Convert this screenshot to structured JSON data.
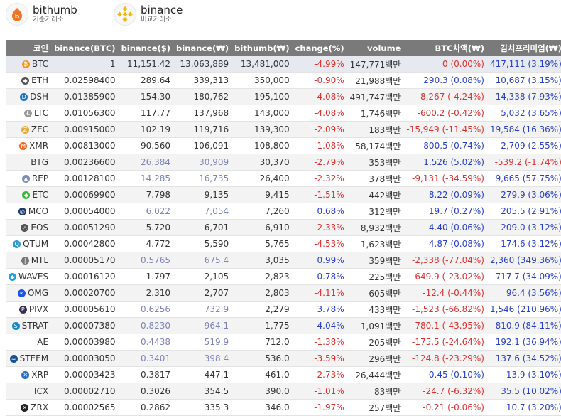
{
  "exchanges": {
    "bithumb": {
      "name": "bithumb",
      "sub": "기준거래소"
    },
    "binance": {
      "name": "binance",
      "sub": "비교거래소"
    }
  },
  "columns": [
    "코인",
    "binance(BTC)",
    "binance($)",
    "binance(₩)",
    "bithumb(₩)",
    "change(%)",
    "volume",
    "BTC차액(₩)",
    "김치프리미엄(₩)"
  ],
  "rows": [
    {
      "coin": "BTC",
      "icon": "bitcoin-icon",
      "icolor": "#f7931a",
      "glyph": "₿",
      "bbtc": "1",
      "busd": "11,151.42",
      "bkrw": "13,063,889",
      "bth": "13,481,000",
      "chg": "-4.99%",
      "vol": "147,771백만",
      "diff": "0 (0.00%)",
      "kimchi": "417,111 (3.19%)",
      "dimUsd": false
    },
    {
      "coin": "ETH",
      "icon": "ethereum-icon",
      "icolor": "#555",
      "glyph": "◆",
      "bbtc": "0.02598400",
      "busd": "289.64",
      "bkrw": "339,313",
      "bth": "350,000",
      "chg": "-0.90%",
      "vol": "21,988백만",
      "diff": "290.3 (0.08%)",
      "kimchi": "10,687 (3.15%)",
      "dimUsd": false
    },
    {
      "coin": "DSH",
      "icon": "dash-icon",
      "icolor": "#1c75bc",
      "glyph": "D",
      "bbtc": "0.01385900",
      "busd": "154.30",
      "bkrw": "180,762",
      "bth": "195,100",
      "chg": "-4.08%",
      "vol": "491,747백만",
      "diff": "-8,267 (-4.24%)",
      "kimchi": "14,338 (7.93%)",
      "dimUsd": false
    },
    {
      "coin": "LTC",
      "icon": "litecoin-icon",
      "icolor": "#9a9a9a",
      "glyph": "Ł",
      "bbtc": "0.01056300",
      "busd": "117.77",
      "bkrw": "137,968",
      "bth": "143,000",
      "chg": "-4.08%",
      "vol": "1,746백만",
      "diff": "-600.2 (-0.42%)",
      "kimchi": "5,032 (3.65%)",
      "dimUsd": false
    },
    {
      "coin": "ZEC",
      "icon": "zcash-icon",
      "icolor": "#e5a93d",
      "glyph": "Z",
      "bbtc": "0.00915000",
      "busd": "102.19",
      "bkrw": "119,716",
      "bth": "139,300",
      "chg": "-2.09%",
      "vol": "183백만",
      "diff": "-15,949 (-11.45%)",
      "kimchi": "19,584 (16.36%)",
      "dimUsd": false
    },
    {
      "coin": "XMR",
      "icon": "monero-icon",
      "icolor": "#f26822",
      "glyph": "M",
      "bbtc": "0.00813000",
      "busd": "90.560",
      "bkrw": "106,091",
      "bth": "108,800",
      "chg": "-1.08%",
      "vol": "58,174백만",
      "diff": "800.5 (0.74%)",
      "kimchi": "2,709 (2.55%)",
      "dimUsd": false
    },
    {
      "coin": "BTG",
      "icon": "",
      "icolor": "",
      "glyph": "",
      "bbtc": "0.00236600",
      "busd": "26.384",
      "bkrw": "30,909",
      "bth": "30,370",
      "chg": "-2.79%",
      "vol": "353백만",
      "diff": "1,526 (5.02%)",
      "kimchi": "-539.2 (-1.74%)",
      "dimUsd": true
    },
    {
      "coin": "REP",
      "icon": "augur-icon",
      "icolor": "#7c8fb3",
      "glyph": "▲",
      "bbtc": "0.00128100",
      "busd": "14.285",
      "bkrw": "16,735",
      "bth": "26,400",
      "chg": "-2.32%",
      "vol": "378백만",
      "diff": "-9,131 (-34.59%)",
      "kimchi": "9,665 (57.75%)",
      "dimUsd": true
    },
    {
      "coin": "ETC",
      "icon": "ethereum-classic-icon",
      "icolor": "#3ab83a",
      "glyph": "◆",
      "bbtc": "0.00069900",
      "busd": "7.798",
      "bkrw": "9,135",
      "bth": "9,415",
      "chg": "-1.51%",
      "vol": "442백만",
      "diff": "8.22 (0.09%)",
      "kimchi": "279.9 (3.06%)",
      "dimUsd": false
    },
    {
      "coin": "MCO",
      "icon": "monaco-icon",
      "icolor": "#1d3a6b",
      "glyph": "◎",
      "bbtc": "0.00054000",
      "busd": "6.022",
      "bkrw": "7,054",
      "bth": "7,260",
      "chg": "0.68%",
      "vol": "312백만",
      "diff": "19.7 (0.27%)",
      "kimchi": "205.5 (2.91%)",
      "dimUsd": true
    },
    {
      "coin": "EOS",
      "icon": "eos-icon",
      "icolor": "#555",
      "glyph": "△",
      "bbtc": "0.00051290",
      "busd": "5.720",
      "bkrw": "6,701",
      "bth": "6,910",
      "chg": "-2.33%",
      "vol": "8,932백만",
      "diff": "4.40 (0.06%)",
      "kimchi": "209.0 (3.12%)",
      "dimUsd": false
    },
    {
      "coin": "QTUM",
      "icon": "qtum-icon",
      "icolor": "#2e9ad0",
      "glyph": "Q",
      "bbtc": "0.00042800",
      "busd": "4.772",
      "bkrw": "5,590",
      "bth": "5,765",
      "chg": "-4.53%",
      "vol": "1,623백만",
      "diff": "4.87 (0.08%)",
      "kimchi": "174.6 (3.12%)",
      "dimUsd": false
    },
    {
      "coin": "MTL",
      "icon": "metal-icon",
      "icolor": "#777",
      "glyph": "|",
      "bbtc": "0.00005170",
      "busd": "0.5765",
      "bkrw": "675.4",
      "bth": "3,035",
      "chg": "0.99%",
      "vol": "359백만",
      "diff": "-2,338 (-77.04%)",
      "kimchi": "2,360 (349.36%)",
      "dimUsd": true
    },
    {
      "coin": "WAVES",
      "icon": "waves-icon",
      "icolor": "#1fa0d8",
      "glyph": "◆",
      "bbtc": "0.00016120",
      "busd": "1.797",
      "bkrw": "2,105",
      "bth": "2,823",
      "chg": "0.78%",
      "vol": "225백만",
      "diff": "-649.9 (-23.02%)",
      "kimchi": "717.7 (34.09%)",
      "dimUsd": false
    },
    {
      "coin": "OMG",
      "icon": "omisego-icon",
      "icolor": "#1a53f0",
      "glyph": "∞",
      "bbtc": "0.00020700",
      "busd": "2.310",
      "bkrw": "2,707",
      "bth": "2,803",
      "chg": "-4.11%",
      "vol": "605백만",
      "diff": "-12.4 (-0.44%)",
      "kimchi": "96.4 (3.56%)",
      "dimUsd": false
    },
    {
      "coin": "PIVX",
      "icon": "pivx-icon",
      "icolor": "#3b2f4f",
      "glyph": "P",
      "bbtc": "0.00005610",
      "busd": "0.6256",
      "bkrw": "732.9",
      "bth": "2,279",
      "chg": "3.78%",
      "vol": "433백만",
      "diff": "-1,523 (-66.82%)",
      "kimchi": "1,546 (210.96%)",
      "dimUsd": true
    },
    {
      "coin": "STRAT",
      "icon": "stratis-icon",
      "icolor": "#1387c9",
      "glyph": "S",
      "bbtc": "0.00007380",
      "busd": "0.8230",
      "bkrw": "964.1",
      "bth": "1,775",
      "chg": "4.04%",
      "vol": "1,091백만",
      "diff": "-780.1 (-43.95%)",
      "kimchi": "810.9 (84.11%)",
      "dimUsd": true
    },
    {
      "coin": "AE",
      "icon": "",
      "icolor": "",
      "glyph": "",
      "bbtc": "0.00003980",
      "busd": "0.4438",
      "bkrw": "519.9",
      "bth": "712.0",
      "chg": "-1.38%",
      "vol": "205백만",
      "diff": "-175.5 (-24.64%)",
      "kimchi": "192.1 (36.94%)",
      "dimUsd": true
    },
    {
      "coin": "STEEM",
      "icon": "steem-icon",
      "icolor": "#1a5099",
      "glyph": "≈",
      "bbtc": "0.00003050",
      "busd": "0.3401",
      "bkrw": "398.4",
      "bth": "536.0",
      "chg": "-3.59%",
      "vol": "296백만",
      "diff": "-124.8 (-23.29%)",
      "kimchi": "137.6 (34.52%)",
      "dimUsd": true
    },
    {
      "coin": "XRP",
      "icon": "ripple-icon",
      "icolor": "#2a6fbf",
      "glyph": "✕",
      "bbtc": "0.00003423",
      "busd": "0.3817",
      "bkrw": "447.1",
      "bth": "461.0",
      "chg": "-2.73%",
      "vol": "26,444백만",
      "diff": "0.45 (0.10%)",
      "kimchi": "13.9 (3.10%)",
      "dimUsd": false
    },
    {
      "coin": "ICX",
      "icon": "",
      "icolor": "",
      "glyph": "",
      "bbtc": "0.00002710",
      "busd": "0.3026",
      "bkrw": "354.5",
      "bth": "390.0",
      "chg": "-1.01%",
      "vol": "83백만",
      "diff": "-24.7 (-6.32%)",
      "kimchi": "35.5 (10.02%)",
      "dimUsd": false
    },
    {
      "coin": "ZRX",
      "icon": "0x-icon",
      "icolor": "#222",
      "glyph": "✕",
      "bbtc": "0.00002565",
      "busd": "0.2862",
      "bkrw": "335.3",
      "bth": "346.0",
      "chg": "-1.97%",
      "vol": "257백만",
      "diff": "-0.21 (-0.06%)",
      "kimchi": "10.7 (3.20%)",
      "dimUsd": false
    }
  ]
}
